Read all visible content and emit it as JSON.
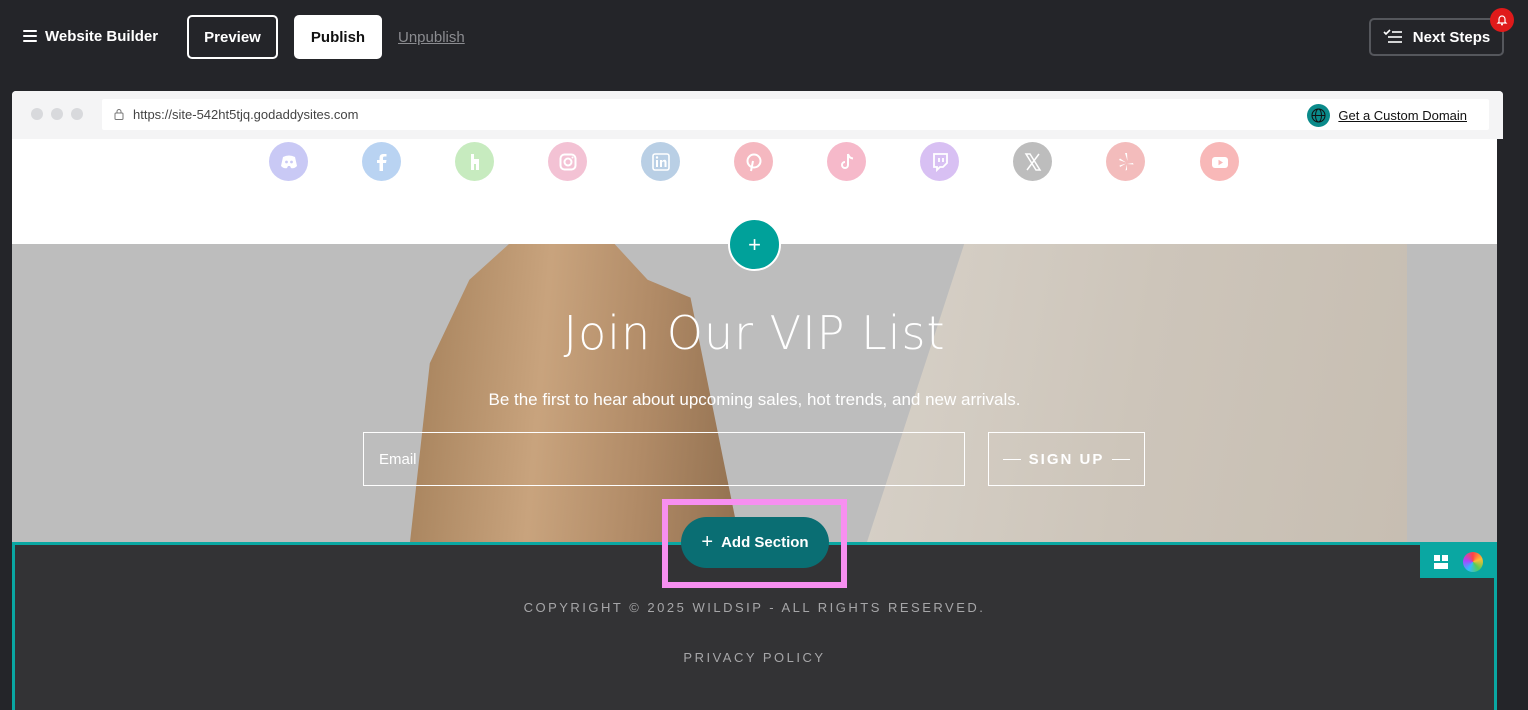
{
  "topbar": {
    "brand": "Website Builder",
    "preview_label": "Preview",
    "publish_label": "Publish",
    "unpublish_label": "Unpublish",
    "next_steps_label": "Next Steps"
  },
  "browser": {
    "url": "https://site-542ht5tjq.godaddysites.com",
    "domain_link": "Get a Custom Domain"
  },
  "social": {
    "icons": [
      {
        "name": "discord-icon",
        "color": "#c9c9f5"
      },
      {
        "name": "facebook-icon",
        "color": "#b9d3f2"
      },
      {
        "name": "houzz-icon",
        "color": "#c7ebbf"
      },
      {
        "name": "instagram-icon",
        "color": "#f3c2d4"
      },
      {
        "name": "linkedin-icon",
        "color": "#b9cfe5"
      },
      {
        "name": "pinterest-icon",
        "color": "#f5b8c0"
      },
      {
        "name": "tiktok-icon",
        "color": "#f6b9ca"
      },
      {
        "name": "twitch-icon",
        "color": "#d8c0f3"
      },
      {
        "name": "x-icon",
        "color": "#bdbdbd"
      },
      {
        "name": "yelp-icon",
        "color": "#f3bcbc"
      },
      {
        "name": "youtube-icon",
        "color": "#f8b8b8"
      }
    ]
  },
  "vip": {
    "title": "Join Our VIP List",
    "subtitle": "Be the first to hear about upcoming sales, hot trends, and new arrivals.",
    "email_placeholder": "Email",
    "signup_label": "SIGN UP"
  },
  "footer": {
    "copyright": "COPYRIGHT © 2025 WILDSIP - ALL RIGHTS RESERVED.",
    "privacy": "PRIVACY POLICY"
  },
  "add_section_label": "Add Section",
  "colors": {
    "accent": "#00a19a",
    "add_section_bg": "#0a6e73",
    "highlight": "#f78ff0",
    "notification": "#e01a1a"
  }
}
